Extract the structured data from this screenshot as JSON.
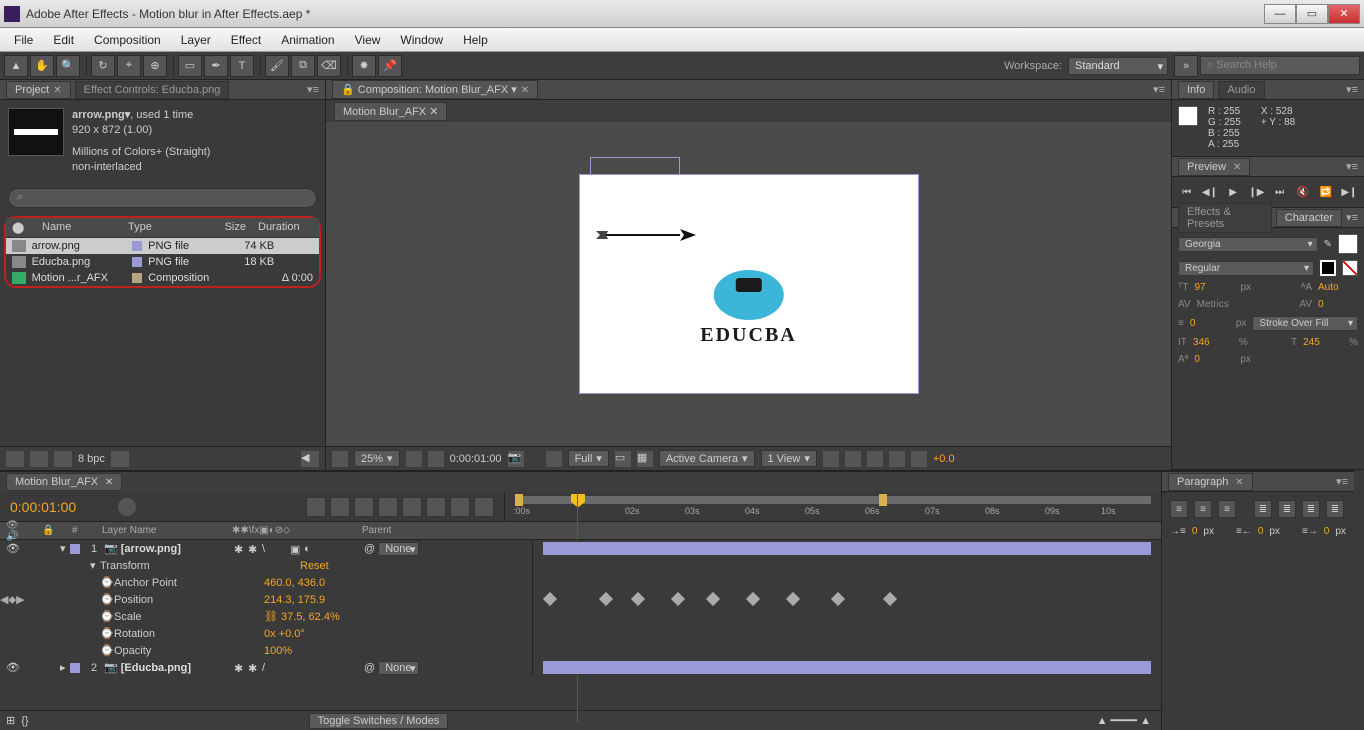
{
  "window": {
    "title": "Adobe After Effects - Motion blur in After Effects.aep *"
  },
  "menu": [
    "File",
    "Edit",
    "Composition",
    "Layer",
    "Effect",
    "Animation",
    "View",
    "Window",
    "Help"
  ],
  "toolbar": {
    "workspace_label": "Workspace:",
    "workspace_value": "Standard",
    "search_placeholder": "Search Help"
  },
  "project_panel": {
    "tab1": "Project",
    "tab2": "Effect Controls: Educba.png",
    "selected_item": {
      "name": "arrow.png▾",
      "usage": ", used 1 time",
      "dims": "920 x 872 (1.00)",
      "colors": "Millions of Colors+ (Straight)",
      "interlace": "non-interlaced"
    },
    "search_icon": "⌕",
    "columns": {
      "name": "Name",
      "type": "Type",
      "size": "Size",
      "duration": "Duration"
    },
    "rows": [
      {
        "name": "arrow.png",
        "type": "PNG file",
        "size": "74 KB",
        "dur": "",
        "sel": true,
        "swatch": "#9a9ad8"
      },
      {
        "name": "Educba.png",
        "type": "PNG file",
        "size": "18 KB",
        "dur": "",
        "swatch": "#9a9ad8"
      },
      {
        "name": "Motion ...r_AFX",
        "type": "Composition",
        "size": "",
        "dur": "Δ 0:00",
        "swatch": "#b5a584"
      }
    ],
    "bpc": "8 bpc"
  },
  "comp_panel": {
    "header": "Composition: Motion Blur_AFX",
    "tab": "Motion Blur_AFX",
    "logo_text": "EDUCBA",
    "bottom": {
      "zoom": "25%",
      "res": "Full",
      "time": "0:00:01:00",
      "camera": "Active Camera",
      "views": "1 View",
      "exposure": "+0.0"
    }
  },
  "info_panel": {
    "tab1": "Info",
    "tab2": "Audio",
    "r": "R : 255",
    "g": "G : 255",
    "b": "B : 255",
    "a": "A : 255",
    "x": "X : 528",
    "y": "Y : 88"
  },
  "preview_panel": {
    "tab": "Preview"
  },
  "char_panel": {
    "tab1": "Effects & Presets",
    "tab2": "Character",
    "font": "Georgia",
    "style": "Regular",
    "size": "97",
    "size_unit": "px",
    "leading": "Auto",
    "tracking": "Metrics",
    "kerning": "0",
    "stroke": "0",
    "stroke_unit": "px",
    "stroke_opt": "Stroke Over Fill",
    "vscale": "346",
    "vscale_unit": "%",
    "hscale": "245",
    "hscale_unit": "%",
    "baseline": "0",
    "baseline_unit": "px"
  },
  "timeline": {
    "tab": "Motion Blur_AFX",
    "current_time": "0:00:01:00",
    "ruler_ticks": [
      ":00s",
      "02s",
      "03s",
      "04s",
      "05s",
      "06s",
      "07s",
      "08s",
      "09s",
      "10s"
    ],
    "col_layer": "Layer Name",
    "col_parent": "Parent",
    "layers": [
      {
        "num": "1",
        "name": "[arrow.png]",
        "parent": "None",
        "props": [
          {
            "name": "Transform",
            "val": "Reset",
            "sw": ""
          },
          {
            "name": "Anchor Point",
            "val": "460.0, 436.0",
            "sw": "⌚"
          },
          {
            "name": "Position",
            "val": "214.3, 175.9",
            "sw": "⌚",
            "keys": [
              0,
              62,
              130,
              180,
              212,
              250,
              300,
              350
            ]
          },
          {
            "name": "Scale",
            "val": "⛓ 37.5, 62.4%",
            "sw": "⌚"
          },
          {
            "name": "Rotation",
            "val": "0x +0.0°",
            "sw": "⌚"
          },
          {
            "name": "Opacity",
            "val": "100%",
            "sw": "⌚"
          }
        ]
      },
      {
        "num": "2",
        "name": "[Educba.png]",
        "parent": "None"
      }
    ],
    "toggle": "Toggle Switches / Modes"
  },
  "paragraph": {
    "tab": "Paragraph",
    "vals": [
      "0",
      "0",
      "0"
    ],
    "unit": "px"
  }
}
